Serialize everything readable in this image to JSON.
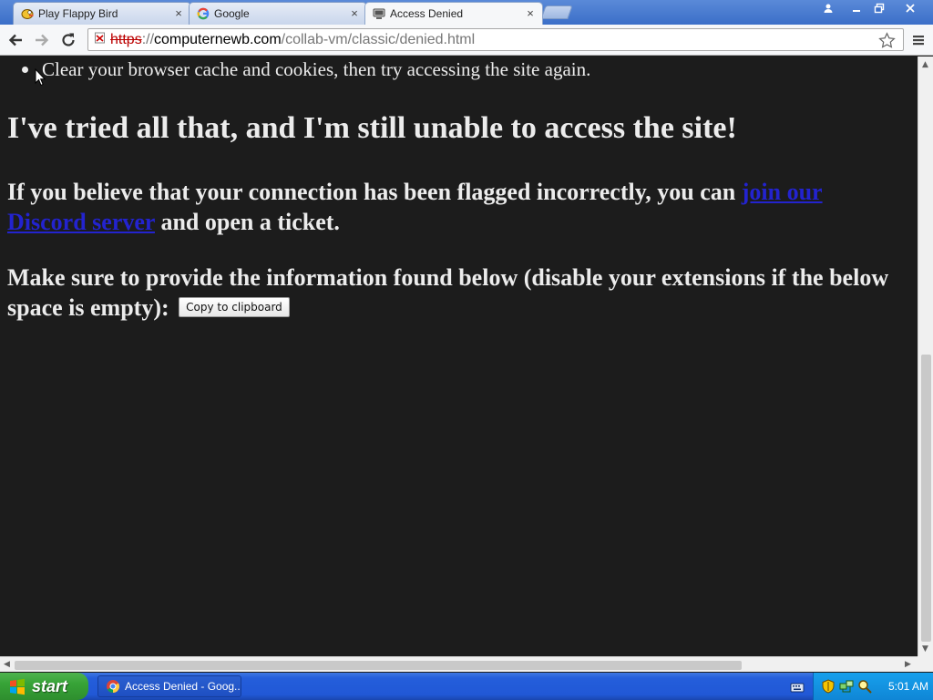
{
  "browser": {
    "tabs": [
      {
        "title": "Play Flappy Bird",
        "icon": "flappy-bird-icon",
        "active": false
      },
      {
        "title": "Google",
        "icon": "google-icon",
        "active": false
      },
      {
        "title": "Access Denied",
        "icon": "collabvm-icon",
        "active": true
      }
    ],
    "tab_close_glyph": "×",
    "address": {
      "scheme": "https",
      "separator": "://",
      "host": "computernewb.com",
      "path": "/collab-vm/classic/denied.html"
    }
  },
  "page": {
    "bullet_text": "Clear your browser cache and cookies, then try accessing the site again.",
    "heading": "I've tried all that, and I'm still unable to access the site!",
    "para1_before": "If you believe that your connection has been flagged incorrectly, you can ",
    "para1_link": "join our Discord server",
    "para1_after": " and open a ticket.",
    "para2_text": "Make sure to provide the information found below (disable your extensions if the below space is empty): ",
    "copy_button": "Copy to clipboard"
  },
  "taskbar": {
    "start_label": "start",
    "task_button": "Access Denied - Goog...",
    "clock": "5:01 AM"
  },
  "colors": {
    "page_background": "#1c1c1c",
    "page_text": "#ececec",
    "link": "#2323cf",
    "taskbar_blue": "#245edb",
    "start_green": "#37a337"
  }
}
